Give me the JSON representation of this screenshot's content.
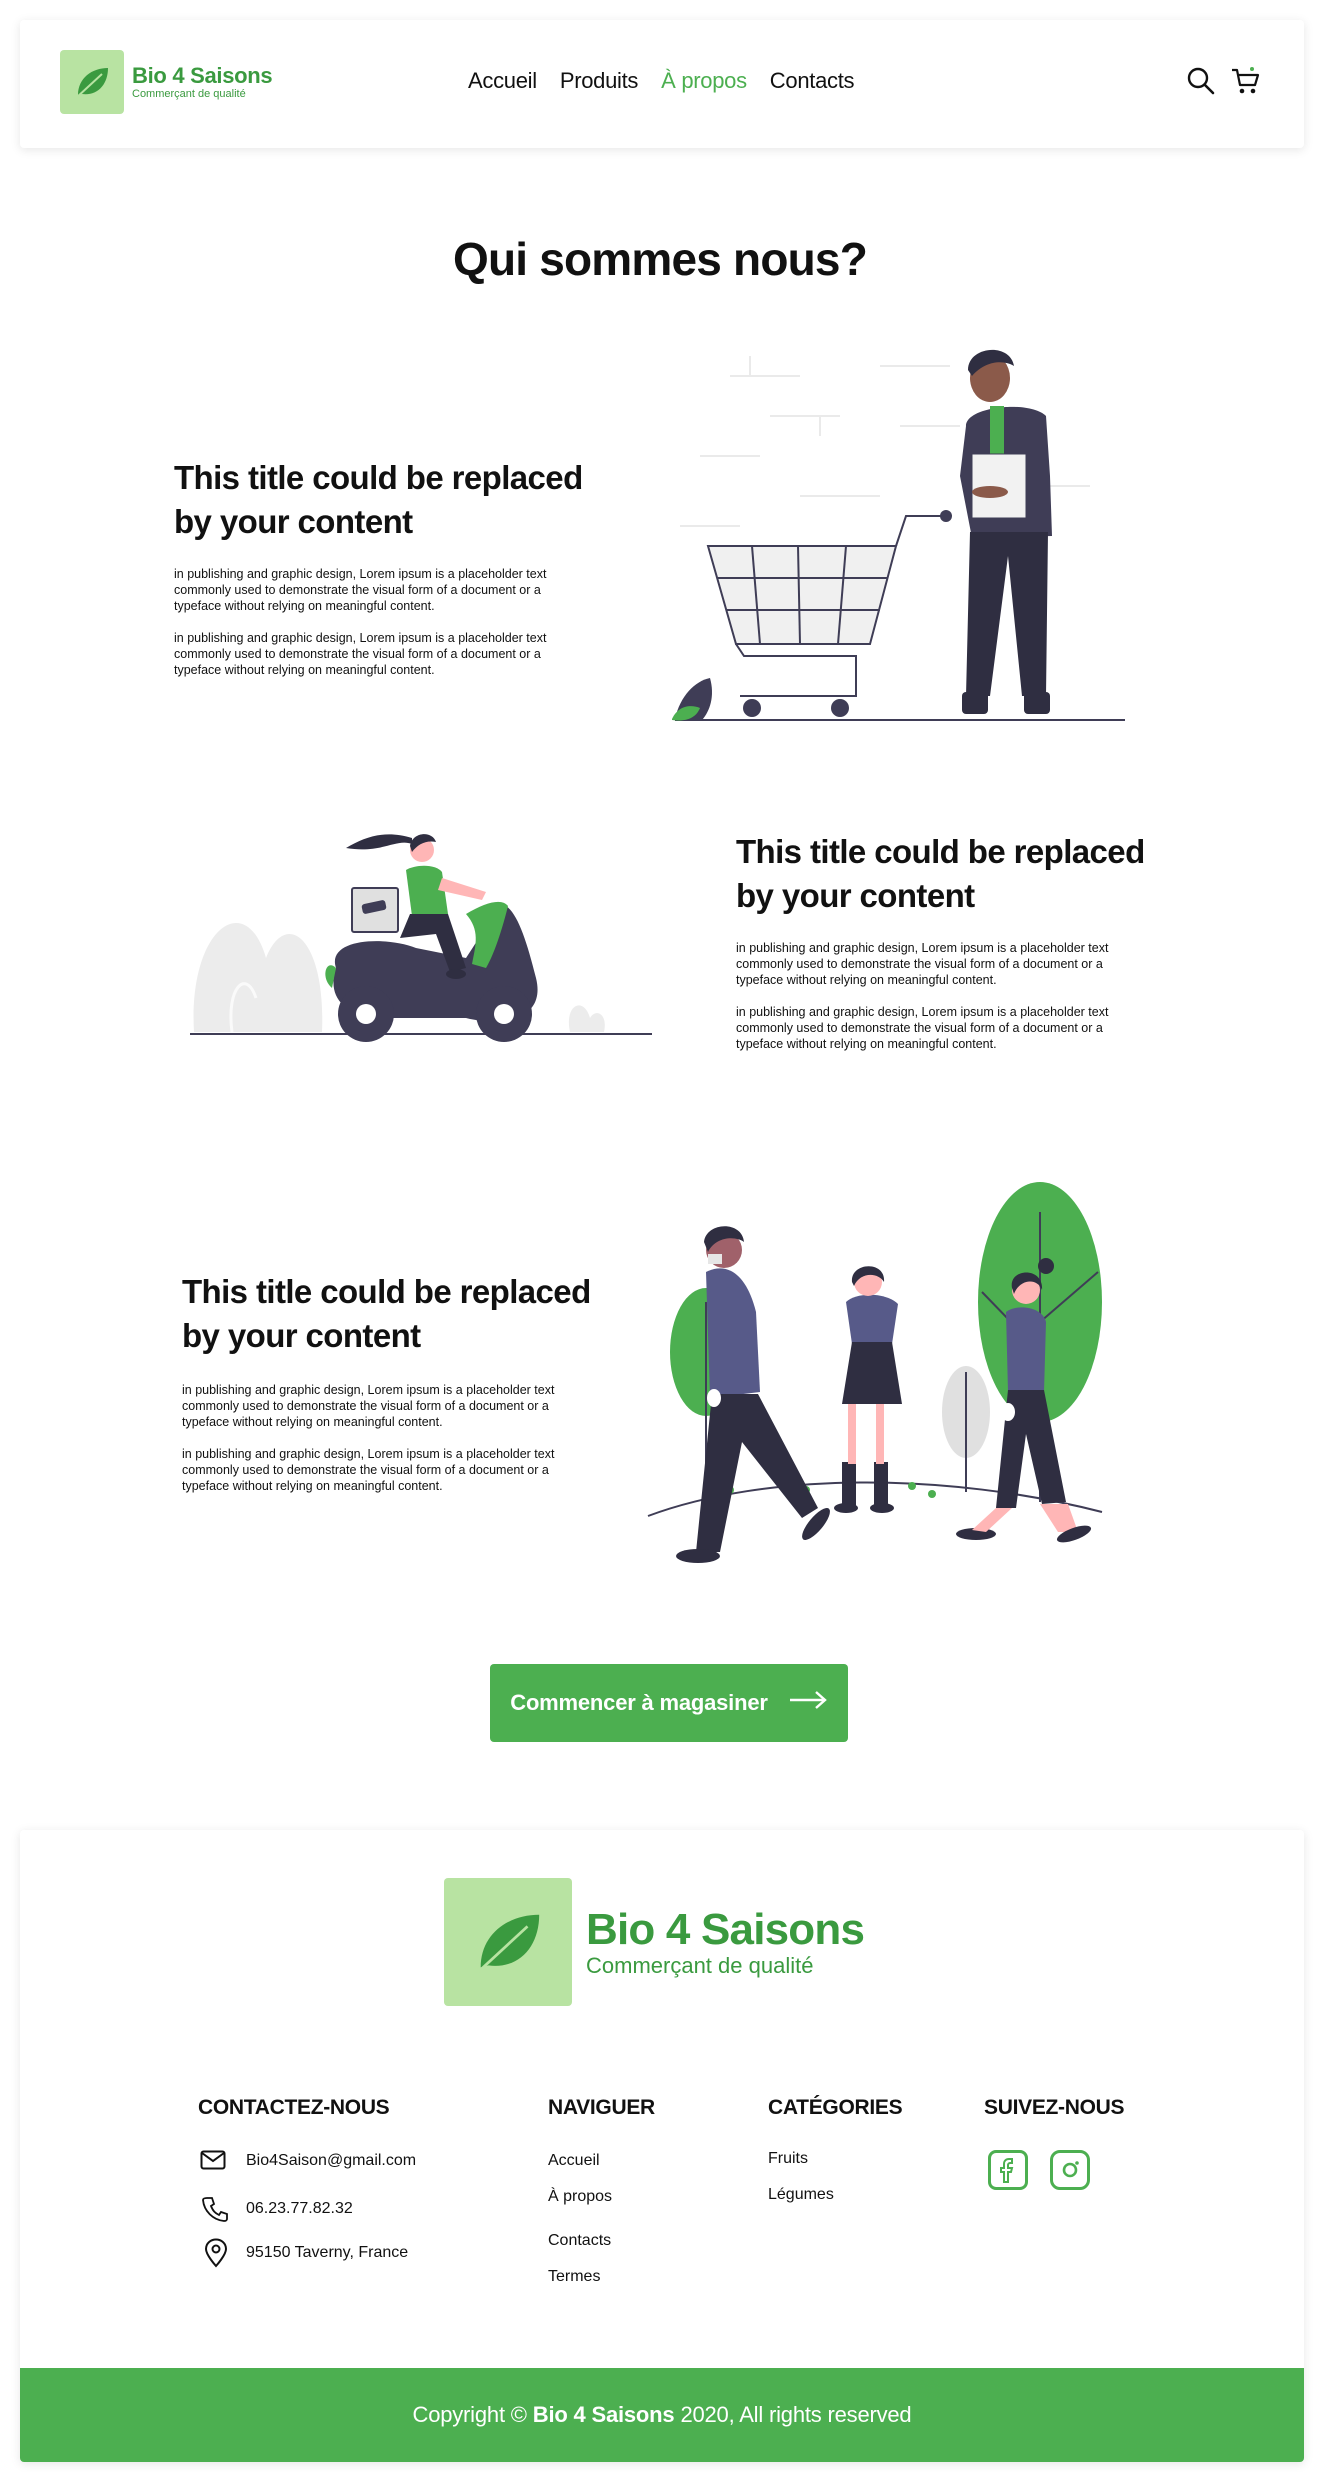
{
  "brand": {
    "name": "Bio 4 Saisons",
    "tagline": "Commerçant de qualité"
  },
  "nav": {
    "items": [
      {
        "label": "Accueil",
        "active": false
      },
      {
        "label": "Produits",
        "active": false
      },
      {
        "label": "À propos",
        "active": true
      },
      {
        "label": "Contacts",
        "active": false
      }
    ]
  },
  "main": {
    "title": "Qui sommes nous?",
    "blocks": [
      {
        "title": "This title could be replaced by your content",
        "paragraphs": [
          "in publishing and graphic design, Lorem ipsum is a placeholder text commonly used to demonstrate the visual form of a document or a typeface without relying on meaningful content.",
          "in publishing and graphic design, Lorem ipsum is a placeholder text commonly used to demonstrate the visual form of a document or a typeface without relying on meaningful content."
        ]
      },
      {
        "title": "This title could be replaced by your content",
        "paragraphs": [
          "in publishing and graphic design, Lorem ipsum is a placeholder text commonly used to demonstrate the visual form of a document or a typeface without relying on meaningful content.",
          "in publishing and graphic design, Lorem ipsum is a placeholder text commonly used to demonstrate the visual form of a document or a typeface without relying on meaningful content."
        ]
      },
      {
        "title": "This title could be replaced by your content",
        "paragraphs": [
          "in publishing and graphic design, Lorem ipsum is a placeholder text commonly used to demonstrate the visual form of a document or a typeface without relying on meaningful content.",
          "in publishing and graphic design, Lorem ipsum is a placeholder text commonly used to demonstrate the visual form of a document or a typeface without relying on meaningful content."
        ]
      }
    ],
    "cta_label": "Commencer à magasiner"
  },
  "footer": {
    "contact": {
      "heading": "CONTACTEZ-NOUS",
      "email": "Bio4Saison@gmail.com",
      "phone": "06.23.77.82.32",
      "address": "95150 Taverny, France"
    },
    "navigate": {
      "heading": "NAVIGUER",
      "items": [
        "Accueil",
        "À propos",
        "Contacts",
        "Termes"
      ]
    },
    "categories": {
      "heading": "CATÉGORIES",
      "items": [
        "Fruits",
        "Légumes"
      ]
    },
    "social": {
      "heading": "SUIVEZ-NOUS",
      "icons": [
        "facebook-icon",
        "instagram-icon"
      ]
    },
    "copyright": {
      "prefix": "Copyright ©",
      "brand": "Bio 4 Saisons",
      "suffix": "2020, All rights reserved"
    }
  },
  "colors": {
    "accent": "#4caf50",
    "brand_green": "#3a9a3f",
    "logo_bg": "#b8e3a2",
    "dark_figure": "#3f3d56",
    "purple_clothing": "#575a89"
  }
}
